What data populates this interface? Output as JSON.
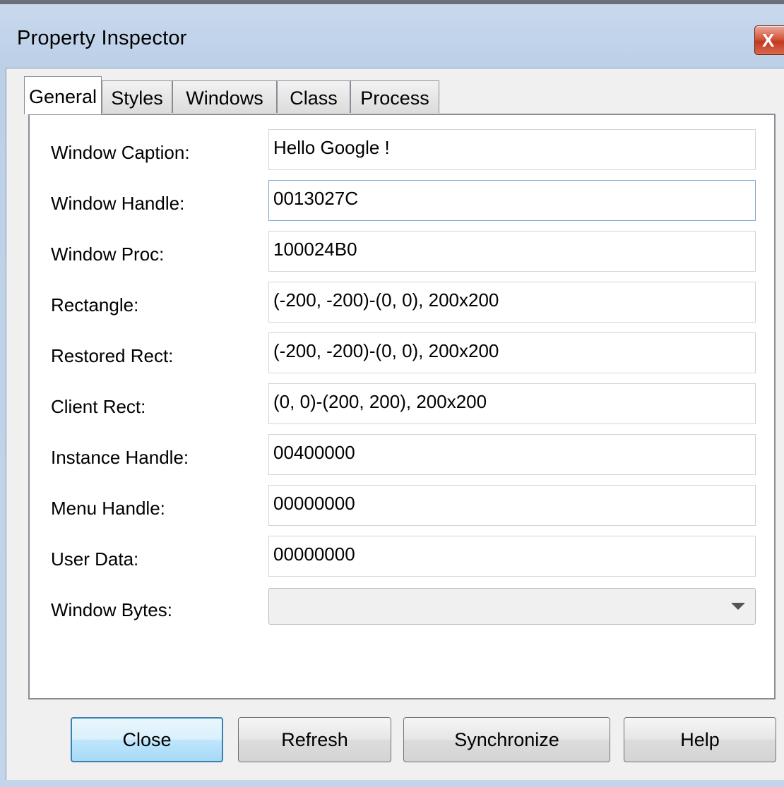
{
  "window": {
    "title": "Property Inspector",
    "close_glyph": "X"
  },
  "tabs": [
    {
      "label": "General",
      "active": true
    },
    {
      "label": "Styles",
      "active": false
    },
    {
      "label": "Windows",
      "active": false
    },
    {
      "label": "Class",
      "active": false
    },
    {
      "label": "Process",
      "active": false
    }
  ],
  "general": {
    "rows": [
      {
        "label": "Window Caption:",
        "value": "Hello Google !"
      },
      {
        "label": "Window Handle:",
        "value": "0013027C"
      },
      {
        "label": "Window Proc:",
        "value": "100024B0"
      },
      {
        "label": "Rectangle:",
        "value": "(-200, -200)-(0, 0), 200x200"
      },
      {
        "label": "Restored Rect:",
        "value": "(-200, -200)-(0, 0), 200x200"
      },
      {
        "label": "Client Rect:",
        "value": "(0, 0)-(200, 200), 200x200"
      },
      {
        "label": "Instance Handle:",
        "value": "00400000"
      },
      {
        "label": "Menu Handle:",
        "value": "00000000"
      },
      {
        "label": "User Data:",
        "value": "00000000"
      }
    ],
    "window_bytes": {
      "label": "Window Bytes:",
      "selected": ""
    }
  },
  "buttons": {
    "close": "Close",
    "refresh": "Refresh",
    "synchronize": "Synchronize",
    "help": "Help"
  }
}
